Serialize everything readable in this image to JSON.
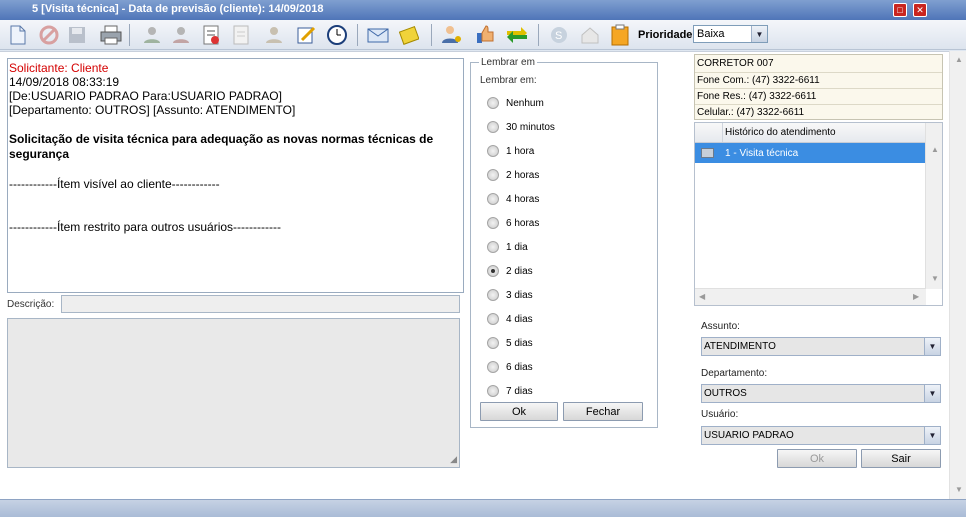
{
  "window": {
    "title": "5 [Visita técnica] - Data de previsão (cliente): 14/09/2018"
  },
  "toolbar": {
    "icons": [
      "new-document-icon",
      "cancel-icon",
      "save-icon",
      "print-icon",
      "user-forward-icon",
      "user-transfer-icon",
      "report-icon",
      "notes-icon",
      "user-icon",
      "edit-icon",
      "clock-icon",
      "email-icon",
      "attach-icon",
      "user-key-icon",
      "thumbs-up-icon",
      "swap-arrows-icon",
      "skype-icon",
      "home-icon",
      "clipboard-icon"
    ],
    "priority_label": "Prioridade:",
    "priority_value": "Baixa"
  },
  "message": {
    "solicitante": "Solicitante: Cliente",
    "datetime": "14/09/2018 08:33:19",
    "from_to": "[De:USUARIO PADRAO Para:USUARIO PADRAO]",
    "dept_subject": "[Departamento: OUTROS] [Assunto: ATENDIMENTO]",
    "subject_text": "Solicitação de visita técnica para adequação as novas normas técnicas de segurança",
    "visible_section": "------------Ítem visível ao cliente------------",
    "restricted_section": "------------Ítem restrito para outros usuários------------"
  },
  "description": {
    "label": "Descrição:",
    "value": ""
  },
  "reminder": {
    "legend": "Lembrar em",
    "label": "Lembrar em:",
    "options": [
      "Nenhum",
      "30 minutos",
      "1 hora",
      "2 horas",
      "4 horas",
      "6 horas",
      "1 dia",
      "2 dias",
      "3 dias",
      "4 dias",
      "5 dias",
      "6 dias",
      "7 dias"
    ],
    "selected": "2 dias",
    "ok_label": "Ok",
    "close_label": "Fechar"
  },
  "contact": {
    "name": "CORRETOR 007",
    "phone_com": "Fone Com.: (47) 3322-6611",
    "phone_res": "Fone Res.: (47) 3322-6611",
    "mobile": "Celular.: (47) 3322-6611"
  },
  "history": {
    "header": "Histórico do atendimento",
    "rows": [
      "1 - Visita técnica"
    ]
  },
  "form": {
    "subject_label": "Assunto:",
    "subject_value": "ATENDIMENTO",
    "department_label": "Departamento:",
    "department_value": "OUTROS",
    "user_label": "Usuário:",
    "user_value": "USUARIO PADRAO",
    "ok_label": "Ok",
    "exit_label": "Sair"
  },
  "colors": {
    "title_bar": "#5a7fc0",
    "selected_row": "#3b8de2",
    "solicitante": "#d40000"
  }
}
